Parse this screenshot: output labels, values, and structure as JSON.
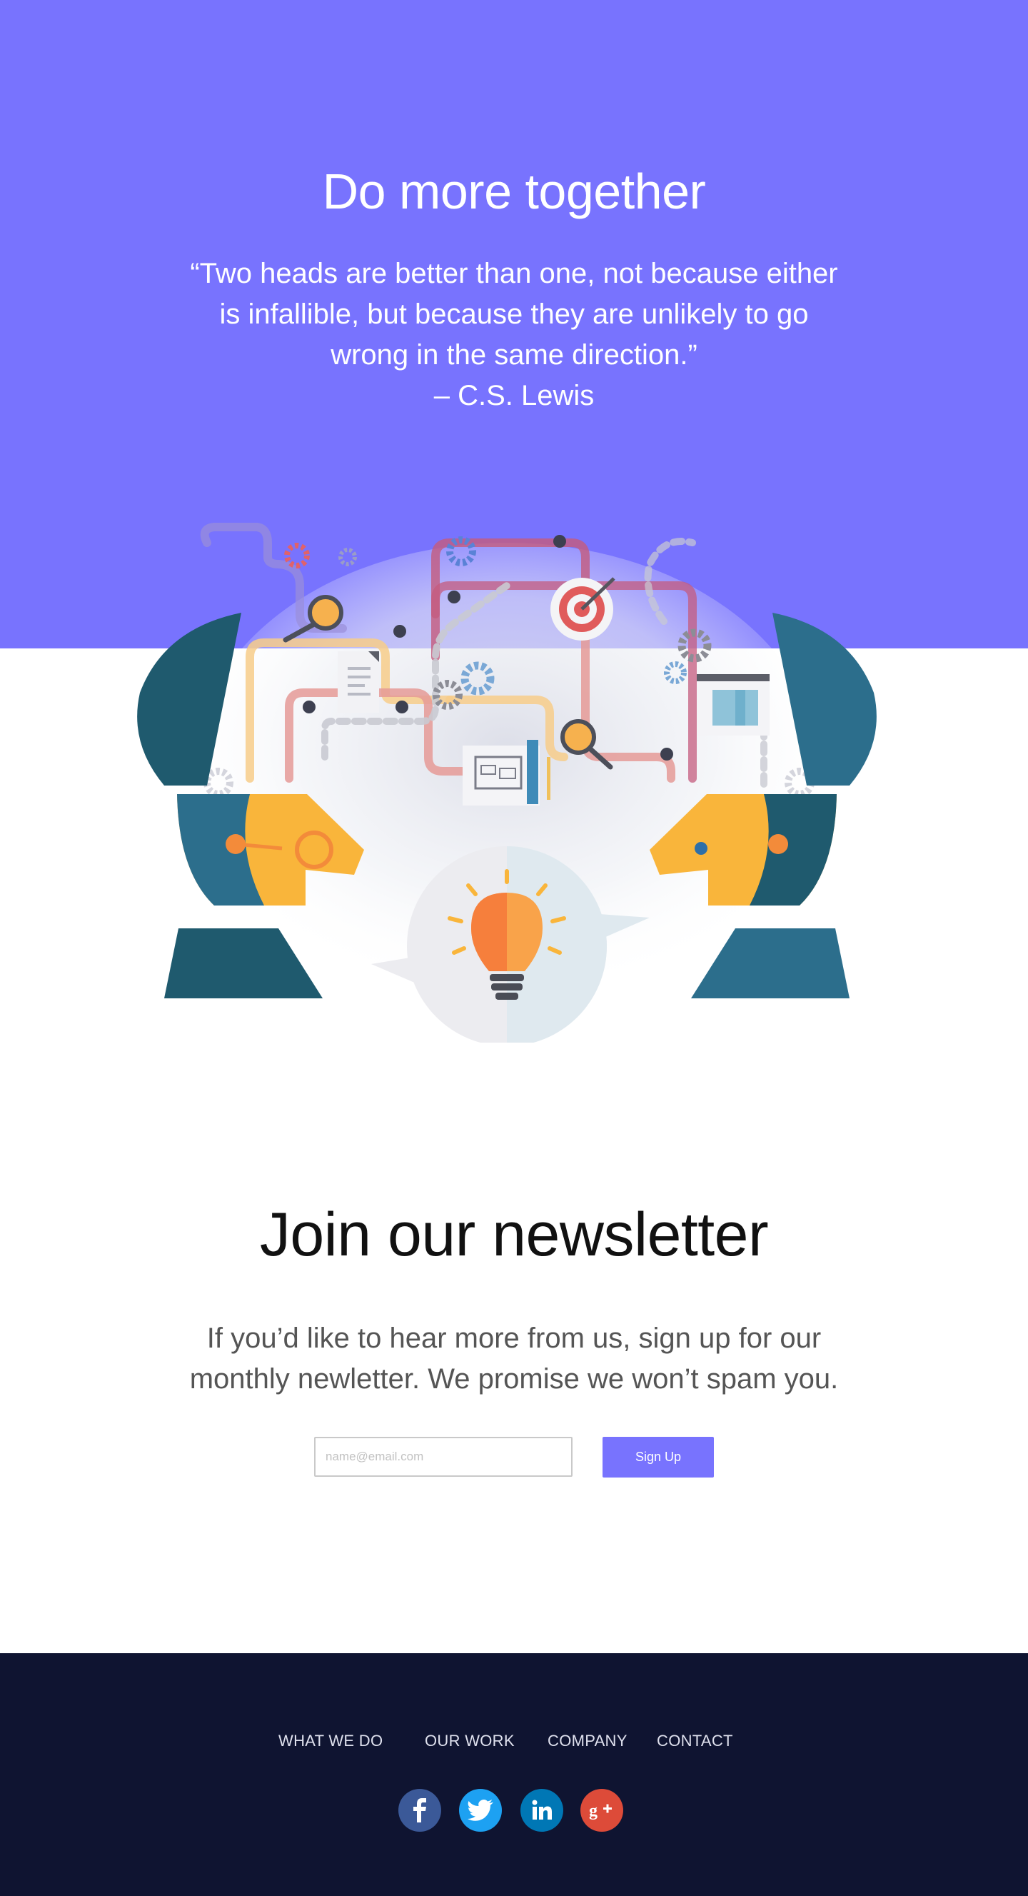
{
  "hero": {
    "title": "Do more together",
    "quote_lines": [
      "“Two heads are better than one, not because either",
      "is infallible, but because they are unlikely to go",
      "wrong in the same direction.”",
      "– C.S. Lewis"
    ]
  },
  "newsletter": {
    "title": "Join our newsletter",
    "text_lines": [
      "If you’d like to hear more from us, sign up for our",
      "monthly newletter. We promise we won’t spam you."
    ],
    "email_placeholder": "name@email.com",
    "email_value": "",
    "signup_label": "Sign Up"
  },
  "footer": {
    "nav": [
      "WHAT WE DO",
      "OUR WORK",
      "COMPANY",
      "CONTACT"
    ],
    "social": [
      {
        "icon": "facebook-icon",
        "glyph": "f",
        "color": "#3b5998"
      },
      {
        "icon": "twitter-icon",
        "glyph": "t",
        "color": "#1da1f2"
      },
      {
        "icon": "linkedin-icon",
        "glyph": "in",
        "color": "#0077b5"
      },
      {
        "icon": "google-plus-icon",
        "glyph": "g+",
        "color": "#dd4b39"
      }
    ]
  },
  "colors": {
    "accent": "#7873fe",
    "footer_bg": "#0f1431"
  }
}
